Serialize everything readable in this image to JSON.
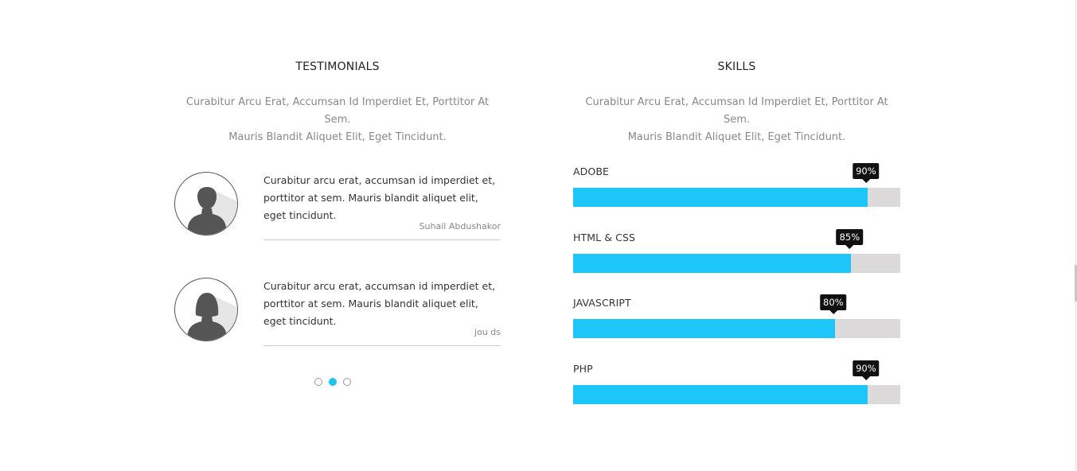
{
  "testimonials": {
    "title": "TESTIMONIALS",
    "description_line1": "Curabitur Arcu Erat, Accumsan Id Imperdiet Et, Porttitor At Sem.",
    "description_line2": "Mauris Blandit Aliquet Elit, Eget Tincidunt.",
    "items": [
      {
        "quote": "Curabitur arcu erat, accumsan id imperdiet et, porttitor at sem. Mauris blandit aliquet elit, eget tincidunt.",
        "author": "Suhail Abdushakor",
        "avatar_icon": "male-user-icon"
      },
      {
        "quote": "Curabitur arcu erat, accumsan id imperdiet et, porttitor at sem. Mauris blandit aliquet elit, eget tincidunt.",
        "author": "jou ds",
        "avatar_icon": "female-user-icon"
      }
    ],
    "pagination": {
      "count": 3,
      "active_index": 1
    }
  },
  "skills": {
    "title": "SKILLS",
    "description_line1": "Curabitur Arcu Erat, Accumsan Id Imperdiet Et, Porttitor At Sem.",
    "description_line2": "Mauris Blandit Aliquet Elit, Eget Tincidunt.",
    "items": [
      {
        "label": "ADOBE",
        "value": 90,
        "display": "90%"
      },
      {
        "label": "HTML & CSS",
        "value": 85,
        "display": "85%"
      },
      {
        "label": "JAVASCRIPT",
        "value": 80,
        "display": "80%"
      },
      {
        "label": "PHP",
        "value": 90,
        "display": "90%"
      }
    ]
  },
  "colors": {
    "accent": "#1cc6f9",
    "track": "#dcd9da",
    "tooltip": "#111111",
    "muted_text": "#888888"
  }
}
